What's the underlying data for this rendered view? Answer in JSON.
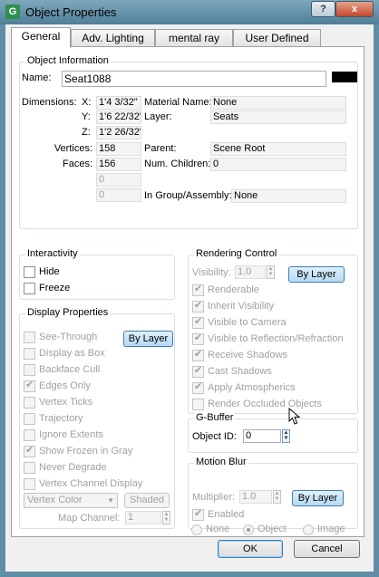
{
  "window": {
    "title": "Object Properties",
    "app_icon": "G",
    "help_button": "?",
    "close_button": "x"
  },
  "tabs": [
    {
      "label": "General",
      "active": true
    },
    {
      "label": "Adv. Lighting",
      "active": false
    },
    {
      "label": "mental ray",
      "active": false
    },
    {
      "label": "User Defined",
      "active": false
    }
  ],
  "object_info": {
    "group_label": "Object Information",
    "name_label": "Name:",
    "name_value": "Seat1088",
    "color_swatch": "#000000",
    "dimensions_label": "Dimensions:",
    "x_label": "X:",
    "x_value": "1'4 3/32\"",
    "y_label": "Y:",
    "y_value": "1'6 22/32\"",
    "z_label": "Z:",
    "z_value": "1'2 26/32\"",
    "vertices_label": "Vertices:",
    "vertices_value": "158",
    "faces_label": "Faces:",
    "faces_value": "156",
    "extra1_value": "0",
    "extra2_value": "0",
    "material_label": "Material Name:",
    "material_value": "None",
    "layer_label": "Layer:",
    "layer_value": "Seats",
    "parent_label": "Parent:",
    "parent_value": "Scene Root",
    "num_children_label": "Num. Children:",
    "num_children_value": "0",
    "in_group_label": "In Group/Assembly:",
    "in_group_value": "None"
  },
  "interactivity": {
    "group_label": "Interactivity",
    "hide_label": "Hide",
    "freeze_label": "Freeze"
  },
  "display": {
    "group_label": "Display Properties",
    "by_layer_label": "By Layer",
    "items": [
      {
        "label": "See-Through",
        "checked": false
      },
      {
        "label": "Display as Box",
        "checked": false
      },
      {
        "label": "Backface Cull",
        "checked": false
      },
      {
        "label": "Edges Only",
        "checked": true
      },
      {
        "label": "Vertex Ticks",
        "checked": false
      },
      {
        "label": "Trajectory",
        "checked": false
      },
      {
        "label": "Ignore Extents",
        "checked": false
      },
      {
        "label": "Show Frozen in Gray",
        "checked": true
      },
      {
        "label": "Never Degrade",
        "checked": false
      },
      {
        "label": "Vertex Channel Display",
        "checked": false
      }
    ],
    "vertex_color_value": "Vertex Color",
    "shaded_label": "Shaded",
    "map_channel_label": "Map Channel:",
    "map_channel_value": "1"
  },
  "rendering": {
    "group_label": "Rendering Control",
    "visibility_label": "Visibility:",
    "visibility_value": "1.0",
    "by_layer_label": "By Layer",
    "items": [
      {
        "label": "Renderable",
        "checked": true
      },
      {
        "label": "Inherit Visibility",
        "checked": true
      },
      {
        "label": "Visible to Camera",
        "checked": true
      },
      {
        "label": "Visible to Reflection/Refraction",
        "checked": true
      },
      {
        "label": "Receive Shadows",
        "checked": true
      },
      {
        "label": "Cast Shadows",
        "checked": true
      },
      {
        "label": "Apply Atmospherics",
        "checked": true
      },
      {
        "label": "Render Occluded Objects",
        "checked": false
      }
    ]
  },
  "gbuffer": {
    "group_label": "G-Buffer",
    "object_id_label": "Object ID:",
    "object_id_value": "0"
  },
  "motion_blur": {
    "group_label": "Motion Blur",
    "multiplier_label": "Multiplier:",
    "multiplier_value": "1.0",
    "by_layer_label": "By Layer",
    "enabled_label": "Enabled",
    "radio_none": "None",
    "radio_object": "Object",
    "radio_image": "Image",
    "selected": "Object"
  },
  "footer": {
    "ok_label": "OK",
    "cancel_label": "Cancel"
  }
}
